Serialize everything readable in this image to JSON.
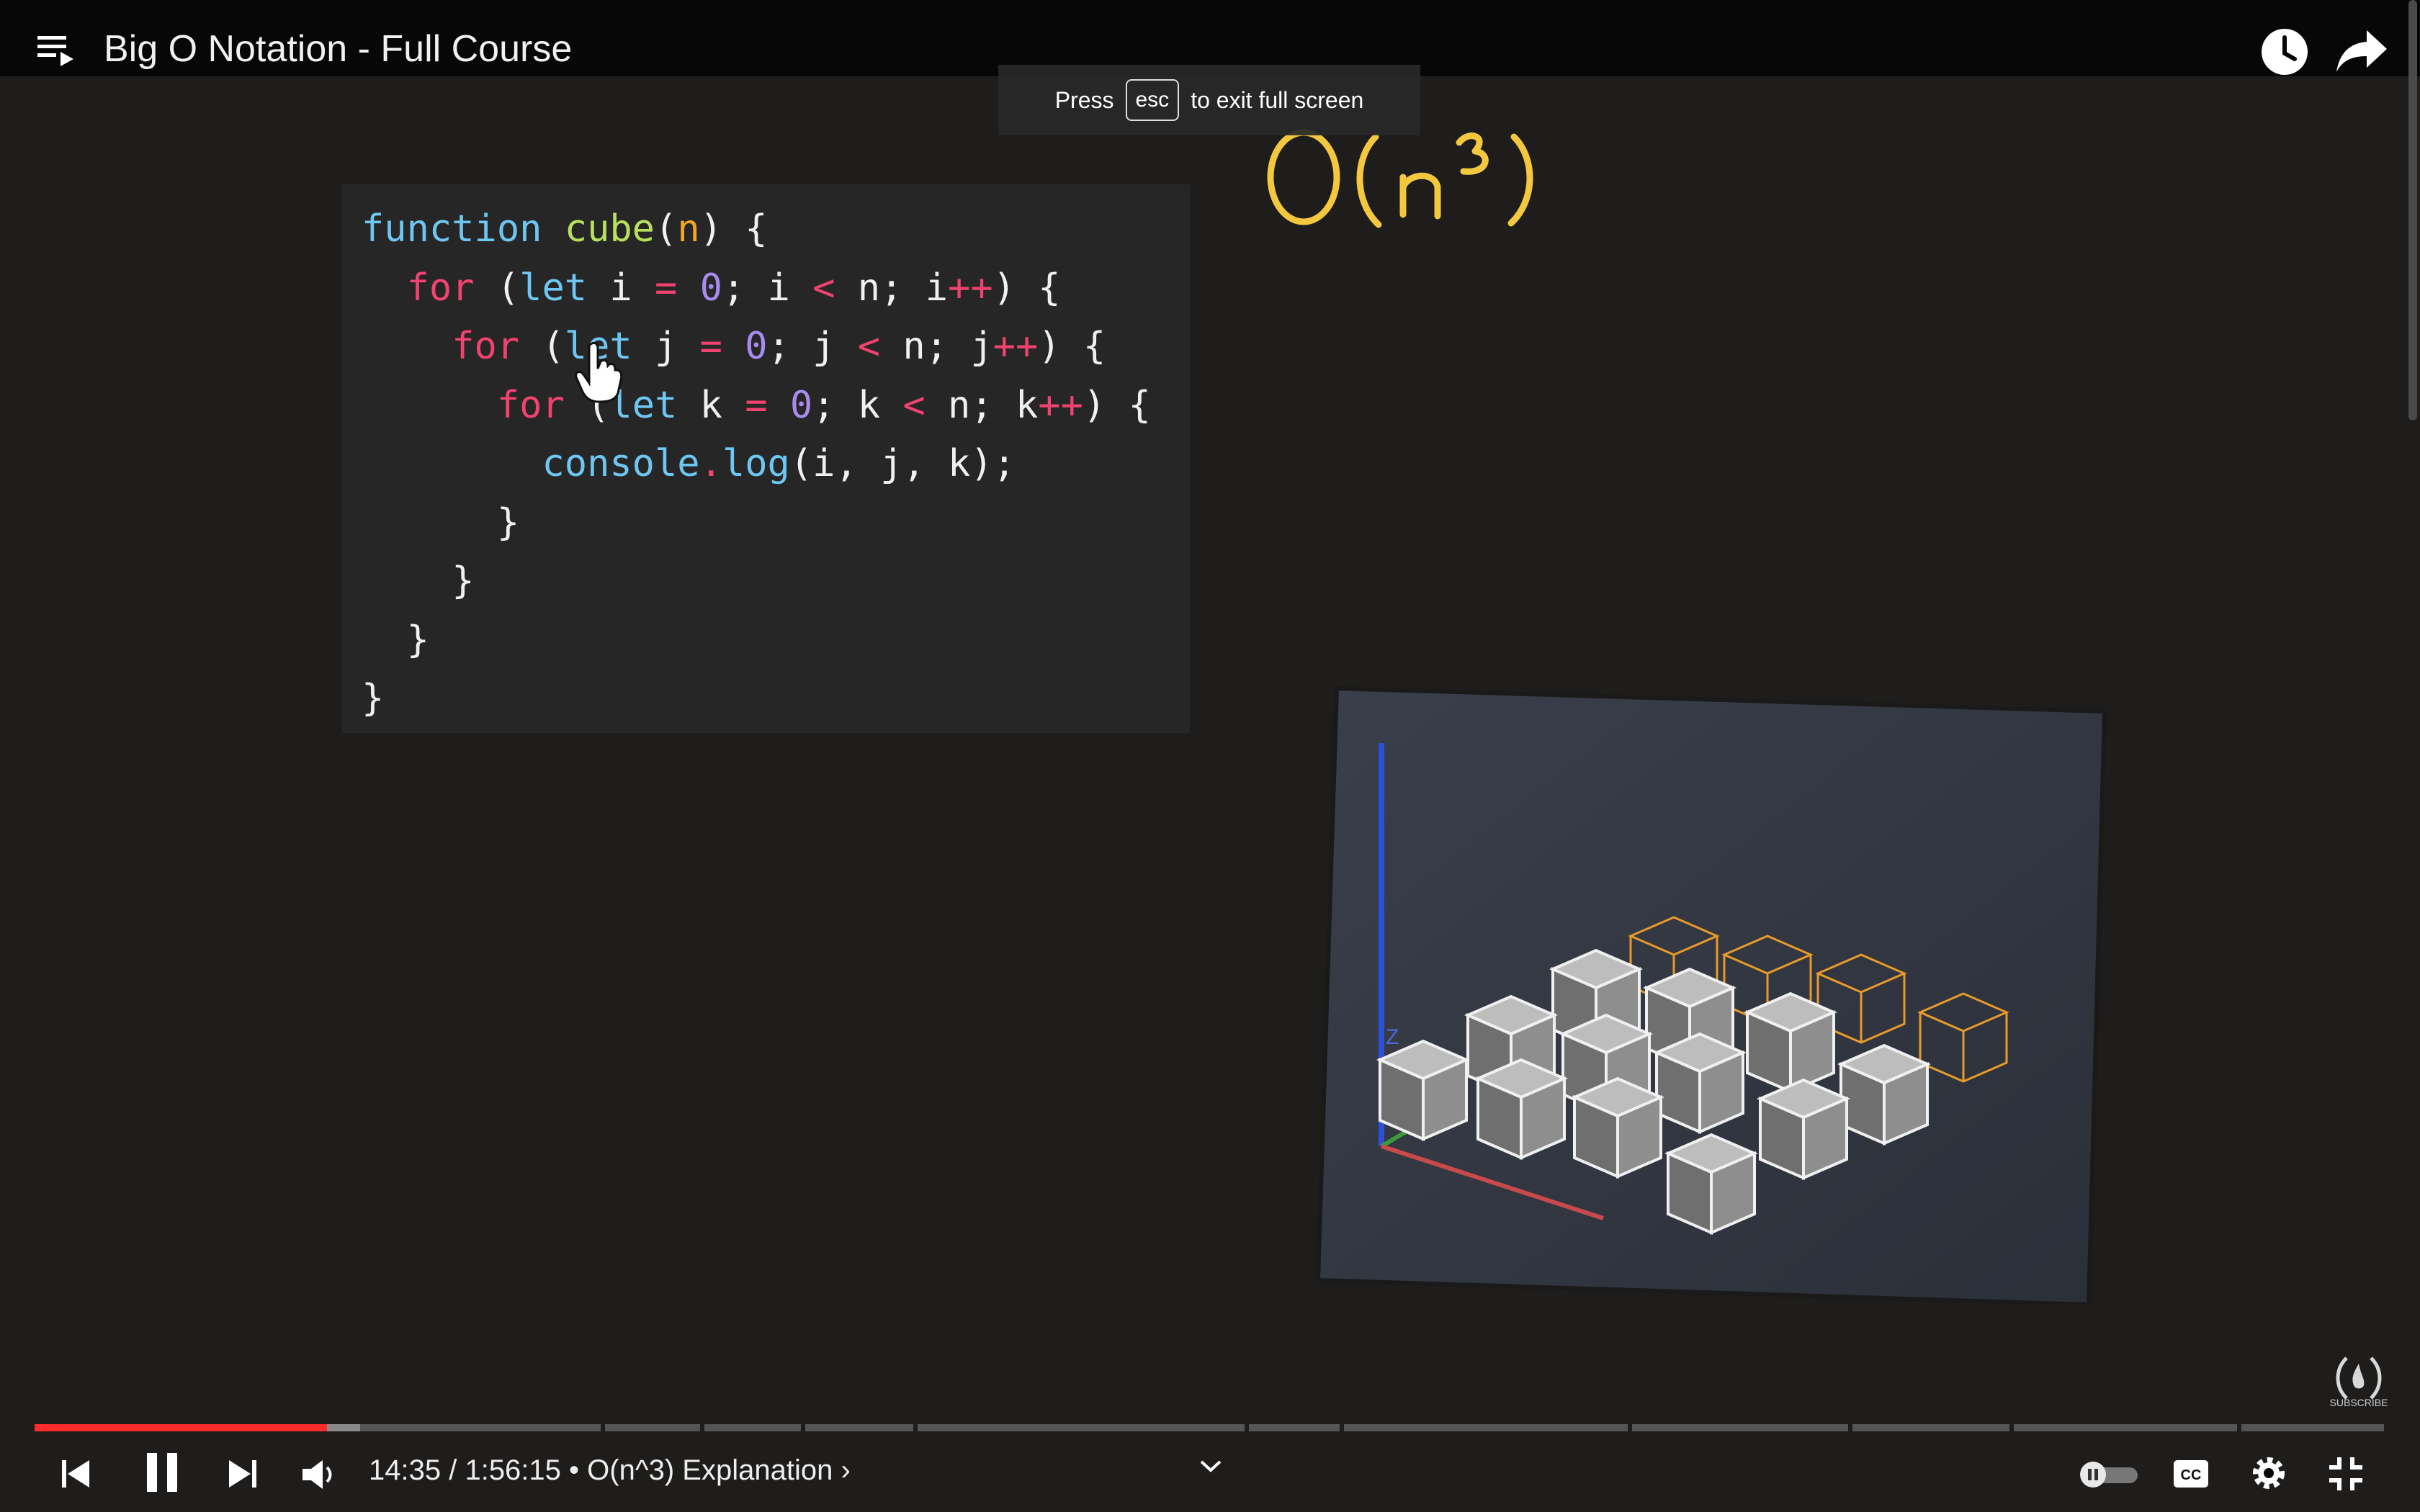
{
  "header": {
    "title": "Big O Notation - Full Course"
  },
  "fullscreen_notice": {
    "prefix": "Press",
    "key": "esc",
    "suffix": "to exit full screen"
  },
  "video_frame": {
    "code_lines": [
      "function cube(n) {",
      "  for (let i = 0; i < n; i++) {",
      "    for (let j = 0; j < n; j++) {",
      "      for (let k = 0; k < n; k++) {",
      "        console.log(i, j, k);",
      "      }",
      "    }",
      "  }",
      "}"
    ],
    "big_o_label": "O(n³)",
    "axis_label": "Z"
  },
  "player": {
    "progress": {
      "played_fraction": 0.1245,
      "buffered_fraction": 0.1387
    },
    "current_time": "14:35",
    "duration": "1:56:15",
    "chapter": "O(n^3) Explanation",
    "subscribe_label": "SUBSCRIBE",
    "autoplay": "on"
  },
  "icons": {
    "playlist": "playlist-icon",
    "watch_later": "clock-icon",
    "share": "share-arrow-icon",
    "prev": "skip-previous-icon",
    "pause": "pause-icon",
    "next": "skip-next-icon",
    "volume": "volume-icon",
    "chapters": "chevron-down-icon",
    "autoplay": "autoplay-toggle-icon",
    "captions": "cc-icon",
    "settings": "gear-icon",
    "exit_fullscreen": "exit-fullscreen-icon"
  },
  "colors": {
    "accent": "#ff0000",
    "big_o_ink": "#f3c83f",
    "box_outline": "#e89a2a"
  }
}
